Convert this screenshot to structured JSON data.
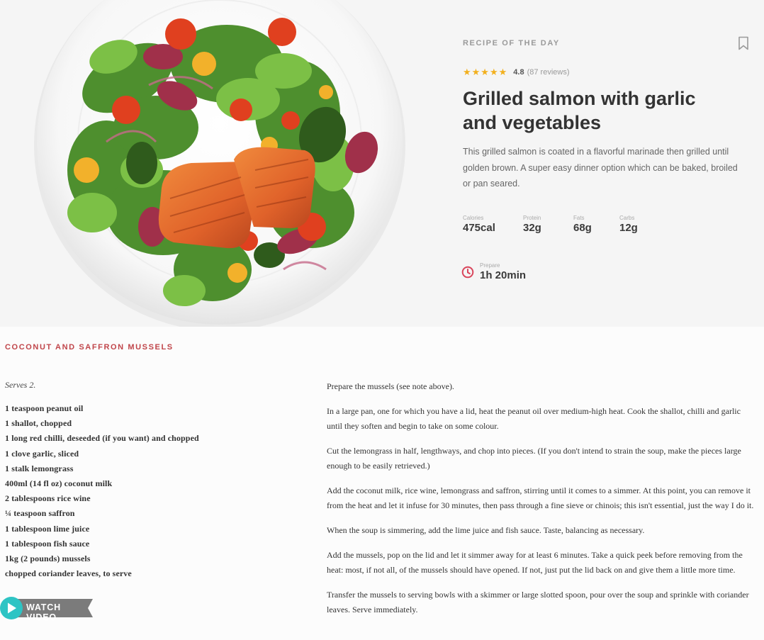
{
  "hero": {
    "label": "RECIPE OF THE DAY",
    "rating": {
      "stars": 5,
      "value": "4.8",
      "reviews": "(87 reviews)"
    },
    "title": "Grilled salmon with garlic and vegetables",
    "description": "This grilled salmon is coated in a flavorful marinade then grilled until golden brown. A super easy dinner option which can be baked, broiled or pan seared.",
    "nutrition": [
      {
        "label": "Calories",
        "value": "475cal"
      },
      {
        "label": "Protein",
        "value": "32g"
      },
      {
        "label": "Fats",
        "value": "68g"
      },
      {
        "label": "Carbs",
        "value": "12g"
      }
    ],
    "prepare": {
      "label": "Prepare",
      "value": "1h 20min"
    },
    "colors": {
      "star": "#f2b01e",
      "clock": "#d9455b",
      "accent": "#c0454a"
    }
  },
  "recipe": {
    "title": "COCONUT AND SAFFRON MUSSELS",
    "serves": "Serves 2.",
    "ingredients": [
      "1 teaspoon peanut oil",
      "1 shallot, chopped",
      "1 long red chilli, deseeded (if you want) and chopped",
      "1 clove garlic, sliced",
      "1 stalk lemongrass",
      "400ml (14 fl oz) coconut milk",
      "2 tablespoons rice wine",
      "¼ teaspoon saffron",
      "1 tablespoon lime juice",
      "1 tablespoon fish sauce",
      "1kg (2 pounds) mussels",
      "chopped coriander leaves, to serve"
    ],
    "steps": [
      "Prepare the mussels (see note above).",
      "In a large pan, one for which you have a lid, heat the peanut oil over medium-high heat. Cook the shallot, chilli and garlic until they soften and begin to take on some colour.",
      "Cut the lemongrass in half, lengthways, and chop into pieces. (If you don't intend to strain the soup, make the pieces large enough to be easily retrieved.)",
      "Add the coconut milk, rice wine, lemongrass and saffron, stirring until it comes to a simmer. At this point, you can remove it from the heat and let it infuse for 30 minutes, then pass through a fine sieve or chinois; this isn't essential, just the way I do it.",
      "When the soup is simmering, add the lime juice and fish sauce. Taste, balancing as necessary.",
      "Add the mussels, pop on the lid and let it simmer away for at least 6 minutes. Take a quick peek before removing from the heat: most, if not all, of the mussels should have opened. If not, just put the lid back on and give them a little more time.",
      "Transfer the mussels to serving bowls with a skimmer or large slotted spoon, pour over the soup and sprinkle with coriander leaves. Serve immediately."
    ],
    "watch_video": "WATCH VIDEO",
    "colors": {
      "play": "#2ec4c4",
      "ribbon": "#7b7b7b"
    }
  }
}
